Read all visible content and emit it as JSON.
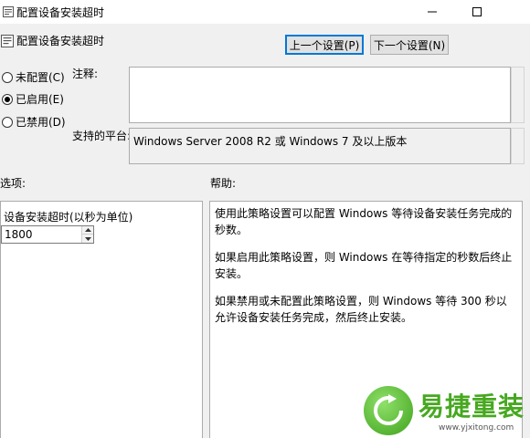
{
  "window": {
    "title": "配置设备安装超时",
    "controls": {
      "minimize": "minimize-icon",
      "maximize": "maximize-icon"
    }
  },
  "header": {
    "title": "配置设备安装超时",
    "prev_button": "上一个设置(P)",
    "next_button": "下一个设置(N)"
  },
  "state": {
    "options": [
      {
        "label": "未配置(C)",
        "checked": false
      },
      {
        "label": "已启用(E)",
        "checked": true
      },
      {
        "label": "已禁用(D)",
        "checked": false
      }
    ]
  },
  "comment": {
    "label": "注释:",
    "value": ""
  },
  "platform": {
    "label": "支持的平台:",
    "value": "Windows Server 2008 R2 或 Windows 7 及以上版本"
  },
  "options_pane": {
    "heading": "选项:",
    "field_label": "设备安装超时(以秒为单位)",
    "field_value": "1800"
  },
  "help_pane": {
    "heading": "帮助:",
    "paragraphs": [
      "使用此策略设置可以配置 Windows 等待设备安装任务完成的秒数。",
      "如果启用此策略设置，则 Windows 在等待指定的秒数后终止安装。",
      "如果禁用或未配置此策略设置，则 Windows 等待 300 秒以允许设备安装任务完成，然后终止安装。"
    ]
  },
  "watermark": {
    "brand": "易捷重装",
    "url": "www.yjxitong.com"
  },
  "colors": {
    "focus_border": "#0078d7",
    "logo_green": "#47a820"
  }
}
